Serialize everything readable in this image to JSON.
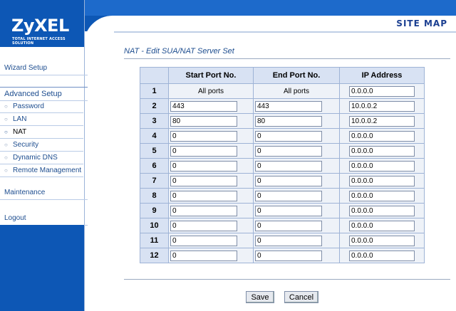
{
  "header": {
    "site_map": "SITE MAP"
  },
  "logo": {
    "brand": "ZyXEL",
    "tagline": "TOTAL INTERNET ACCESS SOLUTION"
  },
  "nav": {
    "wizard_setup": "Wizard Setup",
    "advanced_setup": "Advanced Setup",
    "items": [
      {
        "label": "Password"
      },
      {
        "label": "LAN"
      },
      {
        "label": "NAT"
      },
      {
        "label": "Security"
      },
      {
        "label": "Dynamic DNS"
      },
      {
        "label": "Remote Management"
      }
    ],
    "maintenance": "Maintenance",
    "logout": "Logout"
  },
  "main": {
    "title": "NAT - Edit SUA/NAT Server Set",
    "columns": [
      "",
      "Start Port No.",
      "End Port No.",
      "IP Address"
    ],
    "rows": [
      {
        "num": "1",
        "start": "All ports",
        "end": "All ports",
        "ip": "0.0.0.0"
      },
      {
        "num": "2",
        "start": "443",
        "end": "443",
        "ip": "10.0.0.2"
      },
      {
        "num": "3",
        "start": "80",
        "end": "80",
        "ip": "10.0.0.2"
      },
      {
        "num": "4",
        "start": "0",
        "end": "0",
        "ip": "0.0.0.0"
      },
      {
        "num": "5",
        "start": "0",
        "end": "0",
        "ip": "0.0.0.0"
      },
      {
        "num": "6",
        "start": "0",
        "end": "0",
        "ip": "0.0.0.0"
      },
      {
        "num": "7",
        "start": "0",
        "end": "0",
        "ip": "0.0.0.0"
      },
      {
        "num": "8",
        "start": "0",
        "end": "0",
        "ip": "0.0.0.0"
      },
      {
        "num": "9",
        "start": "0",
        "end": "0",
        "ip": "0.0.0.0"
      },
      {
        "num": "10",
        "start": "0",
        "end": "0",
        "ip": "0.0.0.0"
      },
      {
        "num": "11",
        "start": "0",
        "end": "0",
        "ip": "0.0.0.0"
      },
      {
        "num": "12",
        "start": "0",
        "end": "0",
        "ip": "0.0.0.0"
      }
    ],
    "save_label": "Save",
    "cancel_label": "Cancel"
  },
  "colors": {
    "brand_blue": "#0d57b5",
    "header_cell": "#d8e2f3",
    "body_cell": "#eef2f8"
  }
}
